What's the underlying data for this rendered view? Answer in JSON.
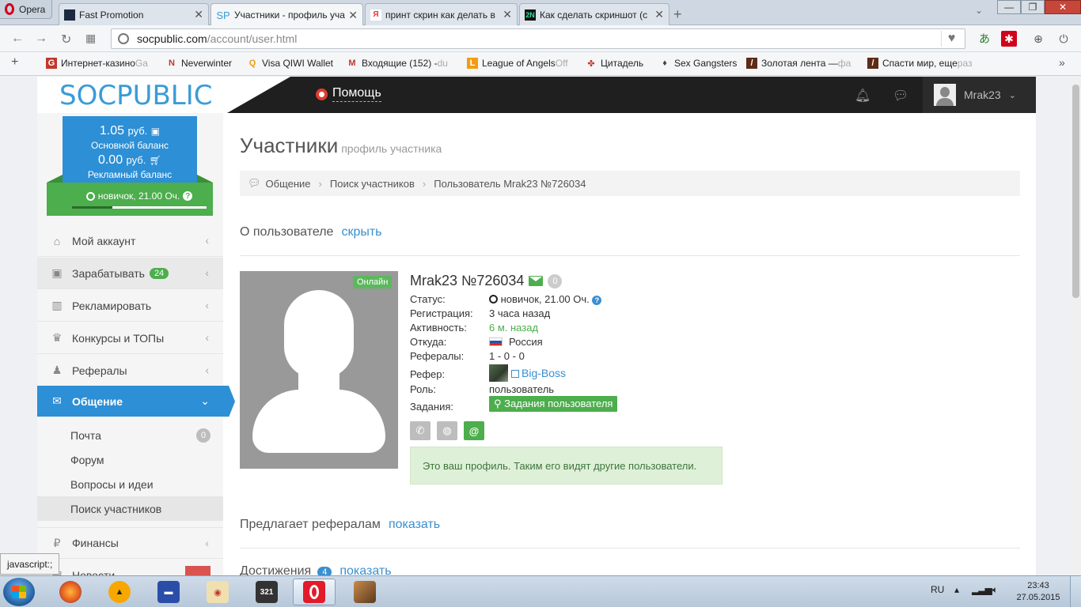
{
  "browser": {
    "menu_label": "Opera",
    "tabs": [
      {
        "title": "Fast Promotion",
        "color": "#1b2a40",
        "glyph": ""
      },
      {
        "title": "Участники - профиль уча",
        "color": "#3a9bd8",
        "glyph": "SP"
      },
      {
        "title": "принт скрин как делать в",
        "color": "#e8352d",
        "glyph": "Я"
      },
      {
        "title": "Как сделать скриншот (с",
        "color": "#0a6a4a",
        "glyph": "2N"
      }
    ],
    "url_host": "socpublic.com",
    "url_path": "/account/user.html",
    "bookmarks": [
      {
        "label": "Интернет-казино",
        "fade": " Ga",
        "icon": "G",
        "color": "#c0392b"
      },
      {
        "label": "Neverwinter",
        "fade": "",
        "icon": "N",
        "color": "#c0392b"
      },
      {
        "label": "Visa QIWI Wallet",
        "fade": "",
        "icon": "Q",
        "color": "#f39c12"
      },
      {
        "label": "Входящие (152) -",
        "fade": " du",
        "icon": "M",
        "color": "#c0392b"
      },
      {
        "label": "League of Angels",
        "fade": " Off",
        "icon": "L",
        "color": "#f39c12"
      },
      {
        "label": "Цитадель",
        "fade": "",
        "icon": "✤",
        "color": "#c0392b"
      },
      {
        "label": "Sex Gangsters",
        "fade": "",
        "icon": "♦",
        "color": "#444"
      },
      {
        "label": "Золотая лента —",
        "fade": " фа",
        "icon": "/",
        "color": "#5d2b16"
      },
      {
        "label": "Спасти мир, еще",
        "fade": " раз",
        "icon": "/",
        "color": "#5d2b16"
      }
    ]
  },
  "site": {
    "logo": "SOCPUBLIC",
    "help_label": "Помощь",
    "username": "Mrak23"
  },
  "sidebar": {
    "balance_main": "1.05",
    "balance_main_unit": "руб.",
    "balance_main_label": "Основной баланс",
    "balance_ad": "0.00",
    "balance_ad_unit": "руб.",
    "balance_ad_label": "Рекламный баланс",
    "status": "новичок, 21.00 Оч.",
    "progress": 0.3,
    "menu": [
      {
        "label": "Мой аккаунт",
        "icon": "⌂"
      },
      {
        "label": "Зарабатывать",
        "icon": "▣",
        "badge": "24"
      },
      {
        "label": "Рекламировать",
        "icon": "▥"
      },
      {
        "label": "Конкурсы и ТОПы",
        "icon": "♛"
      },
      {
        "label": "Рефералы",
        "icon": "♟"
      },
      {
        "label": "Общение",
        "icon": "✉"
      }
    ],
    "submenu": [
      {
        "label": "Почта",
        "badge": "0"
      },
      {
        "label": "Форум"
      },
      {
        "label": "Вопросы и идеи"
      },
      {
        "label": "Поиск участников"
      }
    ],
    "finance_label": "Финансы",
    "finance_icon": "₽",
    "news_label": "Новости"
  },
  "main": {
    "title": "Участники",
    "subtitle": "профиль участника",
    "breadcrumbs": [
      "Общение",
      "Поиск участников",
      "Пользователь Mrak23 №726034"
    ],
    "about_label": "О пользователе",
    "about_toggle": "скрыть",
    "online_label": "Онлайн",
    "profile_name": "Mrak23 №726034",
    "messages_count": "0",
    "fields": {
      "status_label": "Статус:",
      "status_value": "новичок, 21.00 Оч.",
      "reg_label": "Регистрация:",
      "reg_value": "3 часа назад",
      "activity_label": "Активность:",
      "activity_value": "6 м. назад",
      "from_label": "Откуда:",
      "from_value": "Россия",
      "referrals_label": "Рефералы:",
      "referrals_value": "1 - 0 - 0",
      "referrer_label": "Рефер:",
      "referrer_value": "Big-Boss",
      "role_label": "Роль:",
      "role_value": "пользователь",
      "tasks_label": "Задания:",
      "tasks_button": "Задания пользователя"
    },
    "notice": "Это ваш профиль. Таким его видят другие пользователи.",
    "offers_label": "Предлагает рефералам",
    "offers_toggle": "показать",
    "achievements_label": "Достижения",
    "achievements_count": "4",
    "achievements_toggle": "показать"
  },
  "status_tip": "javascript:;",
  "taskbar": {
    "lang": "RU",
    "time": "23:43",
    "date": "27.05.2015"
  }
}
